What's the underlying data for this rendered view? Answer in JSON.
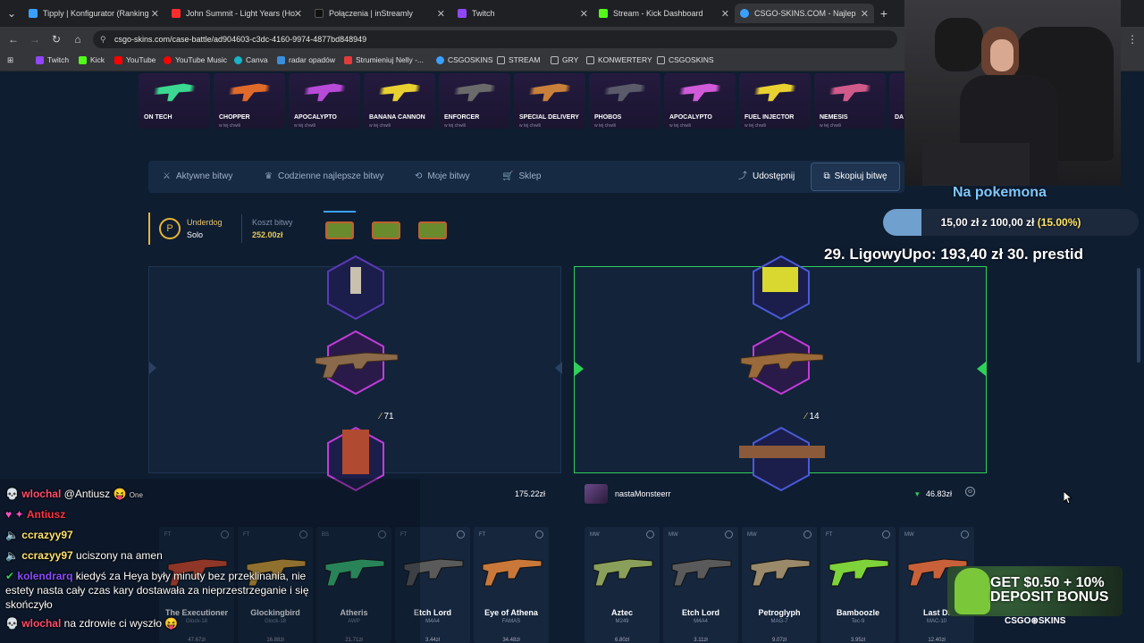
{
  "browser": {
    "tabs": [
      {
        "label": "Tipply | Konfigurator (Ranking",
        "color": "#3aa0ff"
      },
      {
        "label": "John Summit - Light Years (Ho",
        "color": "#ff2d2d"
      },
      {
        "label": "Połączenia | inStreamly",
        "color": "#111111"
      },
      {
        "label": "Twitch",
        "color": "#9146ff"
      },
      {
        "label": "Stream - Kick Dashboard",
        "color": "#53fc18"
      },
      {
        "label": "CSGO-SKINS.COM - Najlep",
        "color": "#3aa0ff"
      }
    ],
    "url": "csgo-skins.com/case-battle/ad904603-c3dc-4160-9974-4877bd848949",
    "bookmarks": [
      {
        "label": "Twitch",
        "color": "#9146ff"
      },
      {
        "label": "Kick",
        "color": "#53fc18"
      },
      {
        "label": "YouTube",
        "color": "#ff0000"
      },
      {
        "label": "YouTube Music",
        "color": "#ff0000"
      },
      {
        "label": "Canva",
        "color": "#18b4c8"
      },
      {
        "label": "radar opadów",
        "color": "#3a8fdc"
      },
      {
        "label": "Strumieniuj Nelly -...",
        "color": "#e23b3b"
      },
      {
        "label": "CSGOSKINS",
        "color": "#3aa0ff"
      },
      {
        "label": "STREAM",
        "color": "#bbbbbb"
      },
      {
        "label": "GRY",
        "color": "#bbbbbb"
      },
      {
        "label": "KONWERTERY",
        "color": "#bbbbbb"
      },
      {
        "label": "CSGOSKINS",
        "color": "#bbbbbb"
      }
    ]
  },
  "live_drops": [
    {
      "name": "ON TECH",
      "sub": ""
    },
    {
      "name": "CHOPPER",
      "sub": "w tej chwili"
    },
    {
      "name": "APOCALYPTO",
      "sub": "w tej chwili"
    },
    {
      "name": "BANANA CANNON",
      "sub": "w tej chwili"
    },
    {
      "name": "ENFORCER",
      "sub": "w tej chwili"
    },
    {
      "name": "SPECIAL DELIVERY",
      "sub": "w tej chwili"
    },
    {
      "name": "PHOBOS",
      "sub": "w tej chwili"
    },
    {
      "name": "APOCALYPTO",
      "sub": "w tej chwili"
    },
    {
      "name": "FUEL INJECTOR",
      "sub": "w tej chwili"
    },
    {
      "name": "NEMESIS",
      "sub": "w tej chwili"
    },
    {
      "name": "DA",
      "sub": ""
    }
  ],
  "nav": {
    "active_battles": "Aktywne bitwy",
    "daily_best": "Codzienne najlepsze bitwy",
    "my_battles": "Moje bitwy",
    "shop": "Sklep",
    "share": "Udostępnij",
    "copy_battle": "Skopiuj bitwę"
  },
  "battle": {
    "mode": "Underdog",
    "type": "Solo",
    "cost_label": "Koszt bitwy",
    "cost": "252.00zł"
  },
  "players": [
    {
      "name": "",
      "total": "175.22zł",
      "reel_value": "71"
    },
    {
      "name": "nastaMonsteerr",
      "total": "46.83zł",
      "reel_value": "14"
    }
  ],
  "drops_left": [
    {
      "cond": "FT",
      "name": "The Executioner",
      "sub": "Glock-18",
      "price": "47.67zł",
      "color": "#d84a2e"
    },
    {
      "cond": "FT",
      "name": "Glockingbird",
      "sub": "Glock-18",
      "price": "16.88zł",
      "color": "#d9a43a"
    },
    {
      "cond": "BS",
      "name": "Atheris",
      "sub": "AWP",
      "price": "21.71zł",
      "color": "#3ac07a"
    },
    {
      "cond": "FT",
      "name": "Etch Lord",
      "sub": "M4A4",
      "price": "3.44zł",
      "color": "#5a5a5a"
    },
    {
      "cond": "FT",
      "name": "Eye of Athena",
      "sub": "FAMAS",
      "price": "34.48zł",
      "color": "#c9783a"
    }
  ],
  "drops_right": [
    {
      "cond": "MW",
      "name": "Aztec",
      "sub": "M249",
      "price": "6.80zł",
      "color": "#8aa05a"
    },
    {
      "cond": "MW",
      "name": "Etch Lord",
      "sub": "M4A4",
      "price": "3.11zł",
      "color": "#5a5a5a"
    },
    {
      "cond": "MW",
      "name": "Petroglyph",
      "sub": "MAG-7",
      "price": "9.07zł",
      "color": "#9a8a6a"
    },
    {
      "cond": "FT",
      "name": "Bamboozle",
      "sub": "Tec-9",
      "price": "3.95zł",
      "color": "#7ed23a"
    },
    {
      "cond": "MW",
      "name": "Last Di",
      "sub": "MAC-10",
      "price": "12.40zł",
      "color": "#c8603a"
    }
  ],
  "overlay": {
    "goal_title": "Na pokemona",
    "goal_progress": "15,00 zł z 100,00 zł",
    "goal_percent": "(15.00%)",
    "goal_fraction": 0.15,
    "ticker": "29. LigowyUpo: 193,40 zł    30. prestid",
    "ad_line1": "GET $0.50 + 10%",
    "ad_line2": "DEPOSIT BONUS",
    "ad_brand": "CSGO⊛SKINS"
  },
  "chat": [
    {
      "user": "wlochal",
      "user_color": "#ff4d6d",
      "text": "@Antiusz 😝",
      "extra": "One"
    },
    {
      "user": "Antiusz",
      "user_color": "#ff3344",
      "text": ""
    },
    {
      "user": "ccrazyy97",
      "user_color": "#ffe26b",
      "text": ""
    },
    {
      "user": "ccrazyy97",
      "user_color": "#ffe26b",
      "text": "uciszony na amen"
    },
    {
      "user": "kolendrarq",
      "user_color": "#8a4bff",
      "text": "kiedyś za Heya były minuty bez przeklinania, nie"
    },
    {
      "user": "",
      "user_color": "#ffffff",
      "text": "estety nasta cały czas kary dostawała za nieprzestrzeganie i się"
    },
    {
      "user": "",
      "user_color": "#ffffff",
      "text": "skończyło"
    },
    {
      "user": "wlochal",
      "user_color": "#ff4d6d",
      "text": "na zdrowie ci wyszło 😝"
    }
  ]
}
